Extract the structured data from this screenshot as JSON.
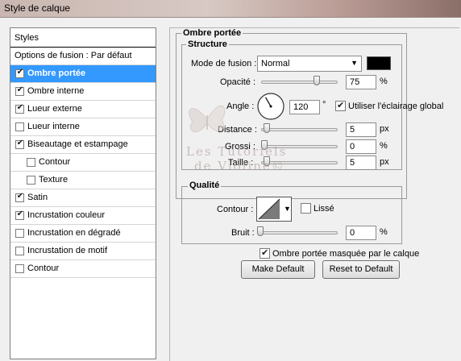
{
  "window": {
    "title": "Style de calque"
  },
  "left_panel": {
    "header": "Styles",
    "items": [
      {
        "label": "Options de fusion : Par défaut",
        "checkbox": false,
        "checked": false,
        "indent": 0
      },
      {
        "label": "Ombre portée",
        "checkbox": true,
        "checked": true,
        "indent": 0,
        "selected": true
      },
      {
        "label": "Ombre interne",
        "checkbox": true,
        "checked": true,
        "indent": 0
      },
      {
        "label": "Lueur externe",
        "checkbox": true,
        "checked": true,
        "indent": 0
      },
      {
        "label": "Lueur interne",
        "checkbox": true,
        "checked": false,
        "indent": 0
      },
      {
        "label": "Biseautage et estampage",
        "checkbox": true,
        "checked": true,
        "indent": 0
      },
      {
        "label": "Contour",
        "checkbox": true,
        "checked": false,
        "indent": 1
      },
      {
        "label": "Texture",
        "checkbox": true,
        "checked": false,
        "indent": 1
      },
      {
        "label": "Satin",
        "checkbox": true,
        "checked": true,
        "indent": 0
      },
      {
        "label": "Incrustation couleur",
        "checkbox": true,
        "checked": true,
        "indent": 0
      },
      {
        "label": "Incrustation en dégradé",
        "checkbox": true,
        "checked": false,
        "indent": 0
      },
      {
        "label": "Incrustation de motif",
        "checkbox": true,
        "checked": false,
        "indent": 0
      },
      {
        "label": "Contour",
        "checkbox": true,
        "checked": false,
        "indent": 0
      }
    ]
  },
  "right_panel": {
    "section_title": "Ombre portée",
    "structure": {
      "title": "Structure",
      "blend_mode_label": "Mode de fusion :",
      "blend_mode_value": "Normal",
      "shadow_color": "#000000",
      "opacity_label": "Opacité :",
      "opacity_value": "75",
      "opacity_unit": "%",
      "opacity_level": 0.75,
      "angle_label": "Angle :",
      "angle_value": "120",
      "angle_unit": "°",
      "global_light_label": "Utiliser l'éclairage global",
      "global_light_checked": true,
      "distance_label": "Distance :",
      "distance_value": "5",
      "distance_unit": "px",
      "spread_label": "Grossi :",
      "spread_value": "0",
      "spread_unit": "%",
      "size_label": "Taille :",
      "size_value": "5",
      "size_unit": "px"
    },
    "quality": {
      "title": "Qualité",
      "contour_label": "Contour :",
      "antialias_label": "Lissé",
      "antialias_checked": false,
      "noise_label": "Bruit :",
      "noise_value": "0",
      "noise_unit": "%"
    },
    "layer_knockout_label": "Ombre portée masquée par le calque",
    "layer_knockout_checked": true,
    "make_default_label": "Make Default",
    "reset_default_label": "Reset to Default"
  },
  "watermark": {
    "line1": "Les Tutoriels",
    "line2": "de Violine©"
  },
  "colors": {
    "selection": "#3399ff",
    "panel_bg": "#f0f0f0"
  }
}
